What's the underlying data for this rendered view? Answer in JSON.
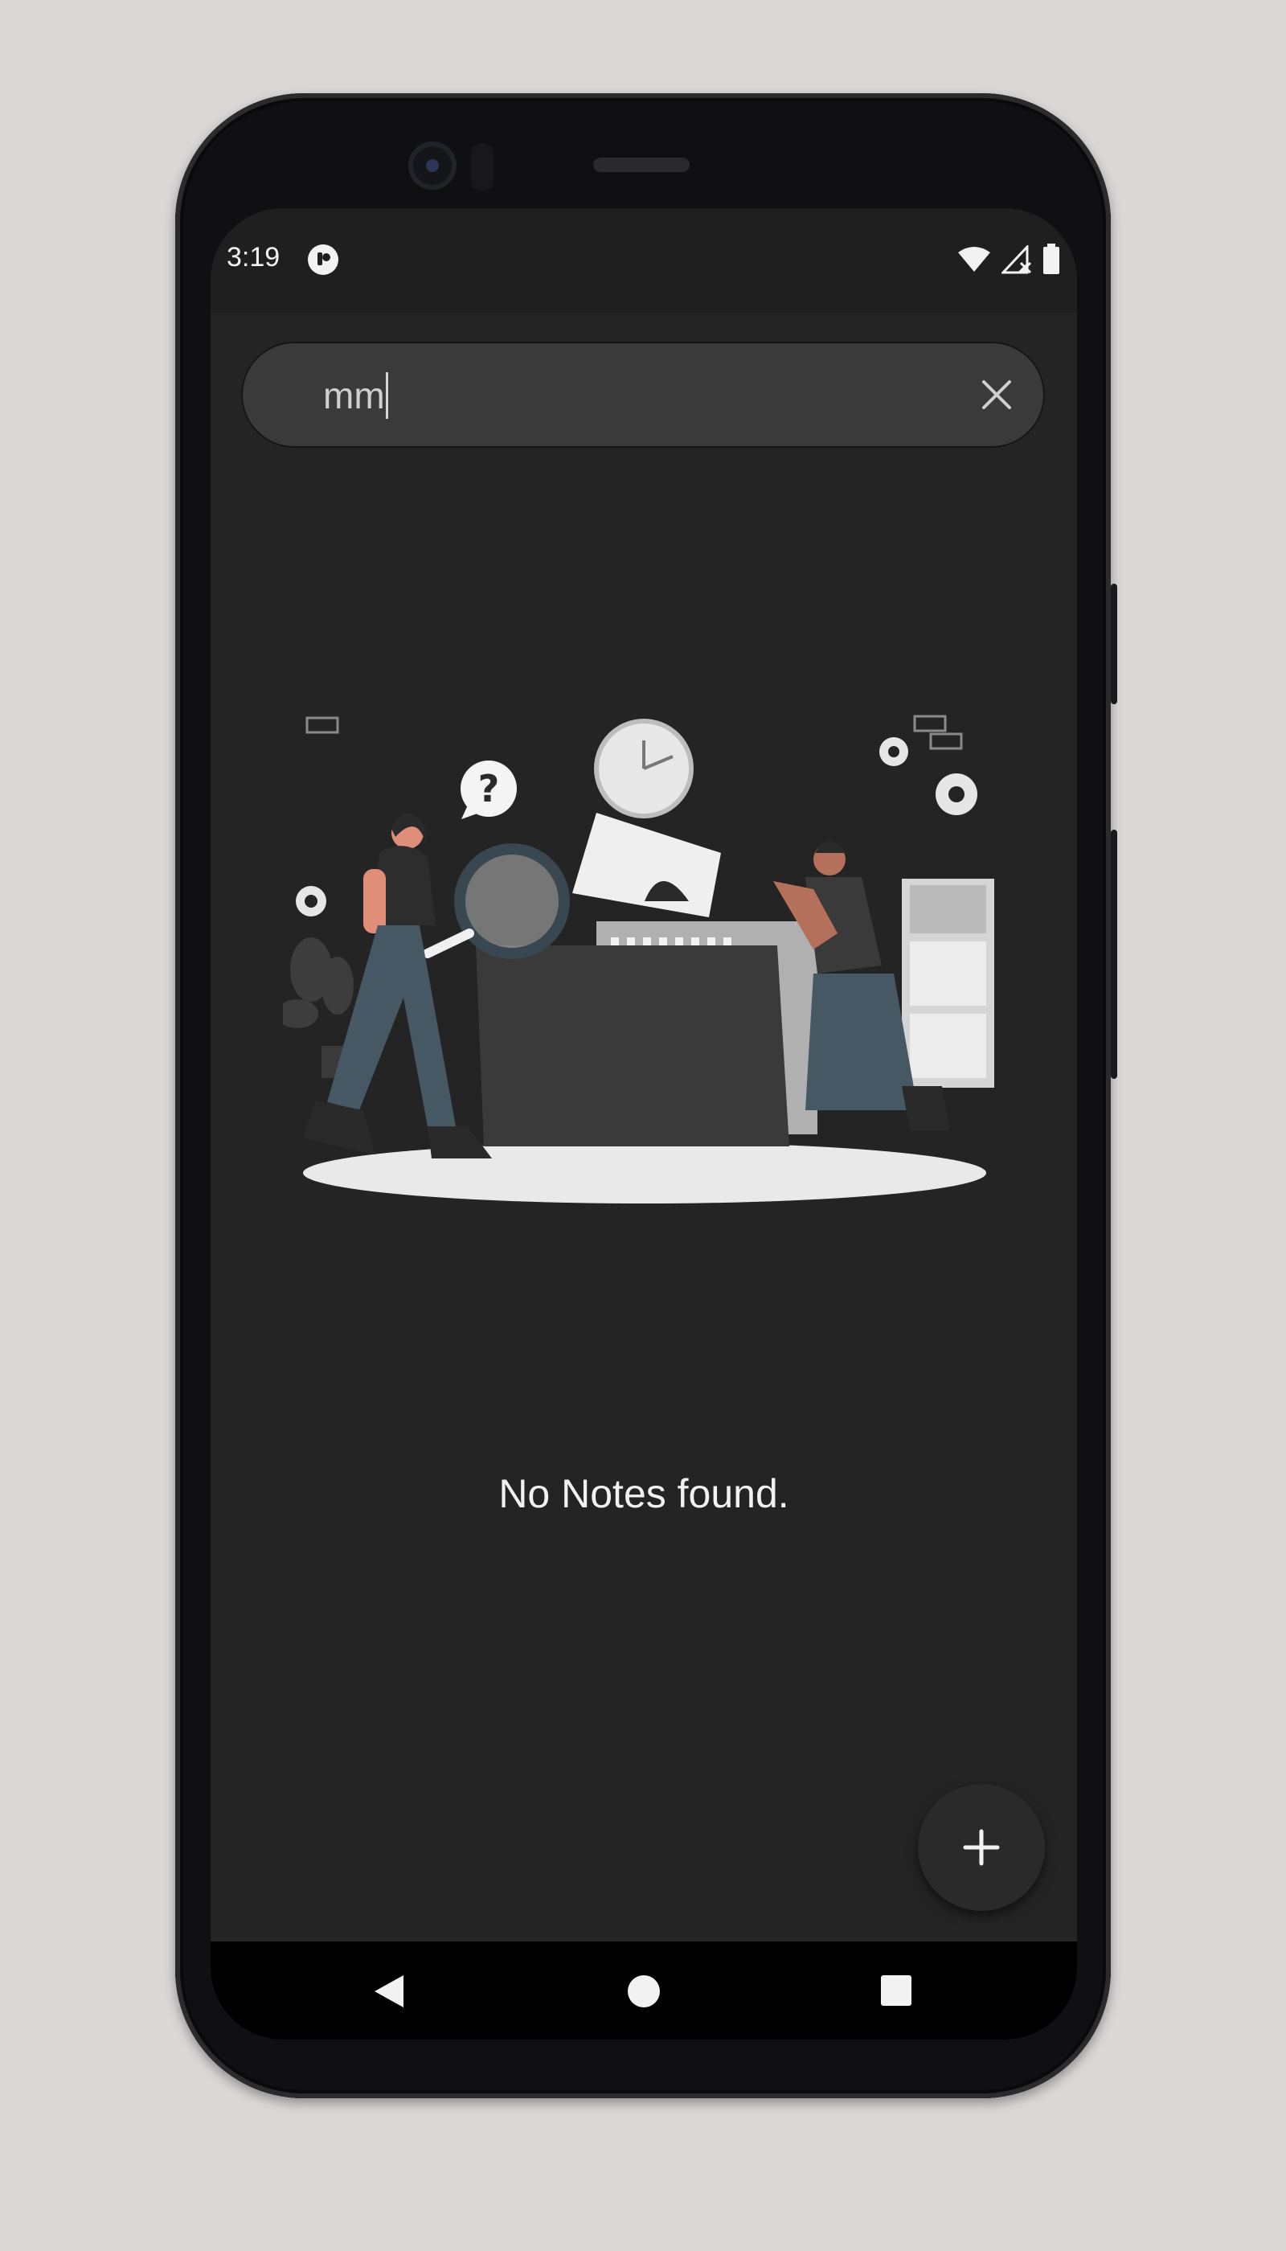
{
  "status_bar": {
    "time": "3:19",
    "icons": [
      "app-notification-icon",
      "wifi-icon",
      "signal-no-data-icon",
      "battery-icon"
    ]
  },
  "search": {
    "value": "mm",
    "placeholder": "",
    "clear_icon": "close-icon"
  },
  "illustration": {
    "question_mark": "?"
  },
  "empty_state": {
    "message": "No Notes found."
  },
  "fab": {
    "label": "+",
    "icon": "plus-icon"
  },
  "navigation": {
    "items": [
      "back-icon",
      "home-icon",
      "recents-icon"
    ]
  },
  "colors": {
    "background": "#242424",
    "surface": "#3a3a3a",
    "text": "#f1f1f1",
    "outer": "#d9d8d6"
  }
}
